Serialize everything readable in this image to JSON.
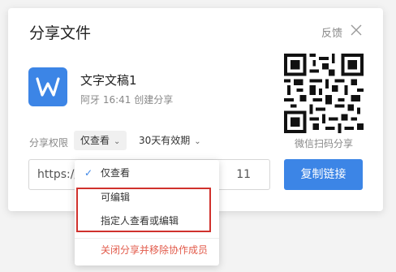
{
  "dialog": {
    "title": "分享文件",
    "feedback_label": "反馈",
    "close_icon": "close-icon"
  },
  "document": {
    "icon": "wps-writer-icon",
    "icon_letter": "W",
    "name": "文字文稿1",
    "meta": "阿牙 16:41 创建分享"
  },
  "qr": {
    "icon": "qr-code",
    "label": "微信扫码分享"
  },
  "permissions": {
    "label": "分享权限",
    "selected": "仅查看",
    "validity": "30天有效期"
  },
  "link": {
    "visible_prefix": "https://",
    "visible_suffix": "11",
    "copy_label": "复制链接"
  },
  "dropdown": {
    "items": [
      {
        "label": "仅查看",
        "selected": true
      },
      {
        "label": "可编辑",
        "selected": false
      },
      {
        "label": "指定人查看或编辑",
        "selected": false
      }
    ],
    "danger_label": "关闭分享并移除协作成员"
  },
  "colors": {
    "accent": "#3c85e6",
    "danger": "#e25b4b",
    "highlight": "#d0312d"
  }
}
